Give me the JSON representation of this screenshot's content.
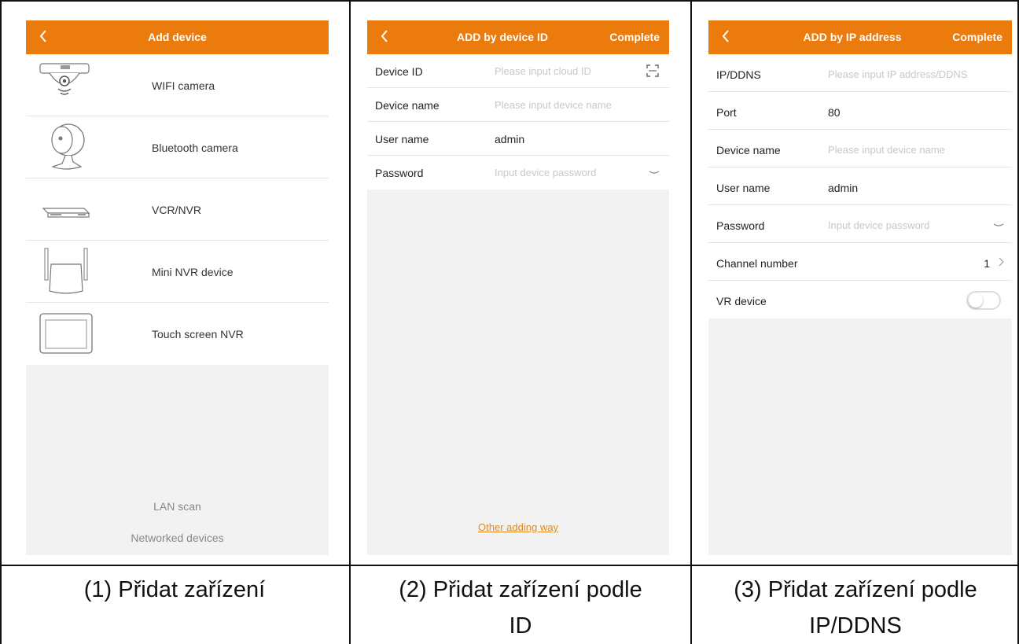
{
  "colors": {
    "accent": "#ec7b0e",
    "link": "#e28a1e",
    "panel_bg": "#f2f2f2"
  },
  "screen1": {
    "title": "Add device",
    "devices": [
      {
        "label": "WIFI camera",
        "icon": "wifi-camera-icon"
      },
      {
        "label": "Bluetooth camera",
        "icon": "bluetooth-camera-icon"
      },
      {
        "label": "VCR/NVR",
        "icon": "nvr-recorder-icon"
      },
      {
        "label": "Mini NVR device",
        "icon": "mini-nvr-icon"
      },
      {
        "label": "Touch screen NVR",
        "icon": "touch-screen-nvr-icon"
      }
    ],
    "lan_scan": "LAN scan",
    "networked_devices": "Networked devices"
  },
  "screen2": {
    "title": "ADD by device ID",
    "complete": "Complete",
    "fields": [
      {
        "label": "Device ID",
        "placeholder": "Please input cloud ID"
      },
      {
        "label": "Device name",
        "placeholder": "Please input device name"
      },
      {
        "label": "User name",
        "value": "admin"
      },
      {
        "label": "Password",
        "placeholder": "Input device password"
      }
    ],
    "other_link": "Other adding way"
  },
  "screen3": {
    "title": "ADD by IP address",
    "complete": "Complete",
    "fields": [
      {
        "label": "IP/DDNS",
        "placeholder": "Please input IP address/DDNS"
      },
      {
        "label": "Port",
        "value": "80"
      },
      {
        "label": "Device name",
        "placeholder": "Please input device name"
      },
      {
        "label": "User name",
        "value": "admin"
      },
      {
        "label": "Password",
        "placeholder": "Input device password"
      },
      {
        "label": "Channel number",
        "value": "1"
      },
      {
        "label": "VR device"
      }
    ]
  },
  "captions": {
    "c1": "(1) Přidat zařízení",
    "c2_line1": "(2) Přidat zařízení podle",
    "c2_line2": "ID",
    "c3_line1": "(3) Přidat zařízení podle",
    "c3_line2": "IP/DDNS"
  }
}
